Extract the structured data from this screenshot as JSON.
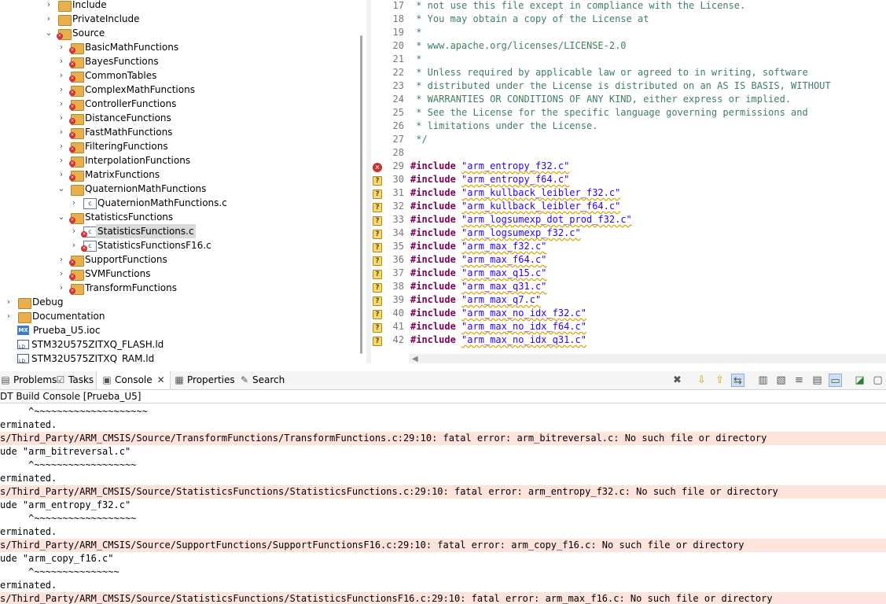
{
  "explorer": {
    "items": [
      {
        "label": "Include",
        "depth": 1,
        "expanded": false,
        "icon": "folder-icon"
      },
      {
        "label": "PrivateInclude",
        "depth": 1,
        "expanded": false,
        "icon": "folder-icon"
      },
      {
        "label": "Source",
        "depth": 1,
        "expanded": true,
        "icon": "source-folder-error-icon"
      },
      {
        "label": "BasicMathFunctions",
        "depth": 2,
        "expanded": false,
        "icon": "folder-error-icon"
      },
      {
        "label": "BayesFunctions",
        "depth": 2,
        "expanded": false,
        "icon": "folder-error-icon"
      },
      {
        "label": "CommonTables",
        "depth": 2,
        "expanded": false,
        "icon": "folder-error-icon"
      },
      {
        "label": "ComplexMathFunctions",
        "depth": 2,
        "expanded": false,
        "icon": "folder-error-icon"
      },
      {
        "label": "ControllerFunctions",
        "depth": 2,
        "expanded": false,
        "icon": "folder-error-icon"
      },
      {
        "label": "DistanceFunctions",
        "depth": 2,
        "expanded": false,
        "icon": "folder-error-icon"
      },
      {
        "label": "FastMathFunctions",
        "depth": 2,
        "expanded": false,
        "icon": "folder-error-icon"
      },
      {
        "label": "FilteringFunctions",
        "depth": 2,
        "expanded": false,
        "icon": "folder-error-icon"
      },
      {
        "label": "InterpolationFunctions",
        "depth": 2,
        "expanded": false,
        "icon": "folder-error-icon"
      },
      {
        "label": "MatrixFunctions",
        "depth": 2,
        "expanded": false,
        "icon": "folder-error-icon"
      },
      {
        "label": "QuaternionMathFunctions",
        "depth": 2,
        "expanded": true,
        "icon": "folder-icon"
      },
      {
        "label": "QuaternionMathFunctions.c",
        "depth": 3,
        "expanded": false,
        "icon": "c-file-icon"
      },
      {
        "label": "StatisticsFunctions",
        "depth": 2,
        "expanded": true,
        "icon": "folder-error-icon"
      },
      {
        "label": "StatisticsFunctions.c",
        "depth": 3,
        "expanded": false,
        "icon": "c-file-error-icon",
        "selected": true
      },
      {
        "label": "StatisticsFunctionsF16.c",
        "depth": 3,
        "expanded": false,
        "icon": "c-file-error-icon"
      },
      {
        "label": "SupportFunctions",
        "depth": 2,
        "expanded": false,
        "icon": "folder-error-icon"
      },
      {
        "label": "SVMFunctions",
        "depth": 2,
        "expanded": false,
        "icon": "folder-error-icon"
      },
      {
        "label": "TransformFunctions",
        "depth": 2,
        "expanded": false,
        "icon": "folder-error-icon"
      },
      {
        "label": "Debug",
        "depth": 0,
        "expanded": false,
        "icon": "folder-icon"
      },
      {
        "label": "Documentation",
        "depth": 0,
        "expanded": false,
        "icon": "folder-icon"
      },
      {
        "label": "Prueba_U5.ioc",
        "depth": 0,
        "leaf": true,
        "icon": "mx-file-icon"
      },
      {
        "label": "STM32U575ZITXQ_FLASH.ld",
        "depth": 0,
        "leaf": true,
        "icon": "ld-file-icon"
      },
      {
        "label": "STM32U575ZITXQ_RAM.ld",
        "depth": 0,
        "leaf": true,
        "icon": "ld-file-icon"
      }
    ]
  },
  "editor": {
    "lines": [
      {
        "n": "17",
        "kind": "comment",
        "text": " * not use this file except in compliance with the License."
      },
      {
        "n": "18",
        "kind": "comment",
        "text": " * You may obtain a copy of the License at"
      },
      {
        "n": "19",
        "kind": "comment",
        "text": " *"
      },
      {
        "n": "20",
        "kind": "comment",
        "text": " * www.apache.org/licenses/LICENSE-2.0"
      },
      {
        "n": "21",
        "kind": "comment",
        "text": " *"
      },
      {
        "n": "22",
        "kind": "comment",
        "text": " * Unless required by applicable law or agreed to in writing, software"
      },
      {
        "n": "23",
        "kind": "comment",
        "text": " * distributed under the License is distributed on an AS IS BASIS, WITHOUT"
      },
      {
        "n": "24",
        "kind": "comment",
        "text": " * WARRANTIES OR CONDITIONS OF ANY KIND, either express or implied."
      },
      {
        "n": "25",
        "kind": "comment",
        "text": " * See the License for the specific language governing permissions and"
      },
      {
        "n": "26",
        "kind": "comment",
        "text": " * limitations under the License."
      },
      {
        "n": "27",
        "kind": "comment",
        "text": " */"
      },
      {
        "n": "28",
        "kind": "blank",
        "text": ""
      },
      {
        "n": "29",
        "kind": "include",
        "marker": "error",
        "text": "\"arm_entropy_f32.c\""
      },
      {
        "n": "30",
        "kind": "include",
        "marker": "warn",
        "text": "\"arm_entropy_f64.c\""
      },
      {
        "n": "31",
        "kind": "include",
        "marker": "warn",
        "text": "\"arm_kullback_leibler_f32.c\""
      },
      {
        "n": "32",
        "kind": "include",
        "marker": "warn",
        "text": "\"arm_kullback_leibler_f64.c\""
      },
      {
        "n": "33",
        "kind": "include",
        "marker": "warn",
        "text": "\"arm_logsumexp_dot_prod_f32.c\""
      },
      {
        "n": "34",
        "kind": "include",
        "marker": "warn",
        "text": "\"arm_logsumexp_f32.c\""
      },
      {
        "n": "35",
        "kind": "include",
        "marker": "warn",
        "text": "\"arm_max_f32.c\""
      },
      {
        "n": "36",
        "kind": "include",
        "marker": "warn",
        "text": "\"arm_max_f64.c\""
      },
      {
        "n": "37",
        "kind": "include",
        "marker": "warn",
        "text": "\"arm_max_q15.c\""
      },
      {
        "n": "38",
        "kind": "include",
        "marker": "warn",
        "text": "\"arm_max_q31.c\""
      },
      {
        "n": "39",
        "kind": "include",
        "marker": "warn",
        "text": "\"arm_max_q7.c\""
      },
      {
        "n": "40",
        "kind": "include",
        "marker": "warn",
        "text": "\"arm_max_no_idx_f32.c\""
      },
      {
        "n": "41",
        "kind": "include",
        "marker": "warn",
        "text": "\"arm_max_no_idx_f64.c\""
      },
      {
        "n": "42",
        "kind": "include",
        "marker": "warn",
        "text": "\"arm_max_no_idx_q31.c\""
      }
    ],
    "include_keyword": "#include"
  },
  "panel": {
    "tabs": [
      {
        "label": "Problems",
        "icon": "problems-icon"
      },
      {
        "label": "Tasks",
        "icon": "tasks-icon"
      },
      {
        "label": "Console",
        "icon": "console-icon",
        "active": true
      },
      {
        "label": "Properties",
        "icon": "properties-icon"
      },
      {
        "label": "Search",
        "icon": "search-icon"
      }
    ],
    "console_title": "DT Build Console [Prueba_U5]"
  },
  "console": {
    "lines": [
      {
        "err": false,
        "text": "     ^~~~~~~~~~~~~~~~~~~~~"
      },
      {
        "err": false,
        "text": "erminated."
      },
      {
        "err": true,
        "text": "s/Third_Party/ARM_CMSIS/Source/TransformFunctions/TransformFunctions.c:29:10: fatal error: arm_bitreversal.c: No such file or directory"
      },
      {
        "err": false,
        "text": "ude \"arm_bitreversal.c\""
      },
      {
        "err": false,
        "text": "     ^~~~~~~~~~~~~~~~~~~"
      },
      {
        "err": false,
        "text": "erminated."
      },
      {
        "err": true,
        "text": "s/Third_Party/ARM_CMSIS/Source/StatisticsFunctions/StatisticsFunctions.c:29:10: fatal error: arm_entropy_f32.c: No such file or directory"
      },
      {
        "err": false,
        "text": "ude \"arm_entropy_f32.c\""
      },
      {
        "err": false,
        "text": "     ^~~~~~~~~~~~~~~~~~~"
      },
      {
        "err": false,
        "text": "erminated."
      },
      {
        "err": true,
        "text": "s/Third_Party/ARM_CMSIS/Source/SupportFunctions/SupportFunctionsF16.c:29:10: fatal error: arm_copy_f16.c: No such file or directory"
      },
      {
        "err": false,
        "text": "ude \"arm_copy_f16.c\""
      },
      {
        "err": false,
        "text": "     ^~~~~~~~~~~~~~~~"
      },
      {
        "err": false,
        "text": "erminated."
      },
      {
        "err": true,
        "text": "s/Third_Party/ARM_CMSIS/Source/StatisticsFunctions/StatisticsFunctionsF16.c:29:10: fatal error: arm_max_f16.c: No such file or directory"
      }
    ]
  }
}
